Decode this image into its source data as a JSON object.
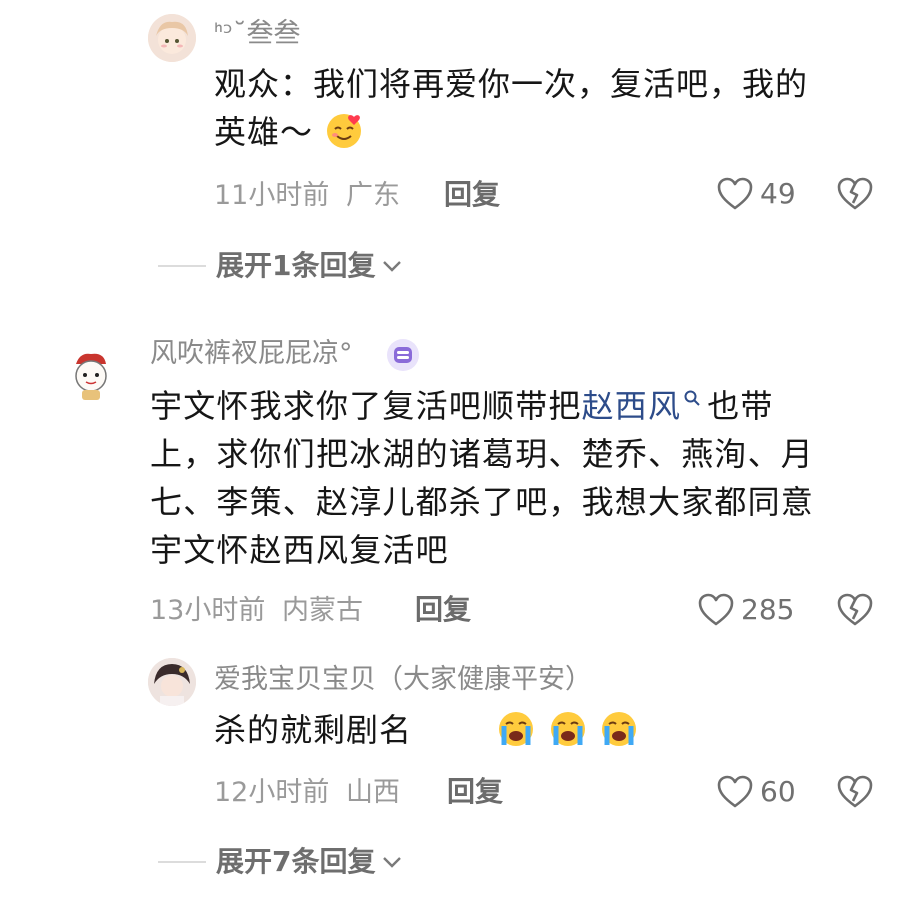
{
  "comments": [
    {
      "username": "ᑋᵓ˘叁叁",
      "text_part1": "观众：我们将再爱你一次，复活吧，我的",
      "text_part2": "英雄～",
      "emoji": "smiling-face-with-heart-emoji",
      "time": "11小时前",
      "location": "广东",
      "reply_label": "回复",
      "likes": "49",
      "expand_label": "展开1条回复"
    },
    {
      "username": "风吹裤衩屁屁凉°",
      "badge": "creator-badge-icon",
      "text_line1_a": "宇文怀我求你了复活吧顺带把",
      "text_line1_link": "赵西风",
      "text_line1_b": "也带",
      "text_line2": "上，求你们把冰湖的诸葛玥、楚乔、燕洵、月",
      "text_line3": "七、李策、赵淳儿都杀了吧，我想大家都同意",
      "text_line4": "宇文怀赵西风复活吧",
      "time": "13小时前",
      "location": "内蒙古",
      "reply_label": "回复",
      "likes": "285"
    },
    {
      "username": "爱我宝贝宝贝（大家健康平安）",
      "text": "杀的就剩剧名",
      "emojis": [
        "loudly-crying-face-emoji",
        "loudly-crying-face-emoji",
        "loudly-crying-face-emoji"
      ],
      "time": "12小时前",
      "location": "山西",
      "reply_label": "回复",
      "likes": "60",
      "expand_label": "展开7条回复"
    }
  ],
  "colors": {
    "text": "#161616",
    "muted": "#9a9a9a",
    "link": "#2d4c8a",
    "badge": "#8a6bd9"
  }
}
